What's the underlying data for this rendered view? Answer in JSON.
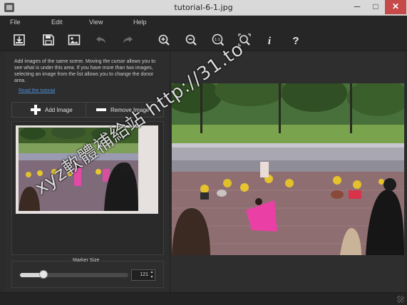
{
  "window": {
    "title": "tutorial-6-1.jpg",
    "min_glyph": "─",
    "max_glyph": "□",
    "close_glyph": "✕"
  },
  "menu": {
    "file": "File",
    "edit": "Edit",
    "view": "View",
    "help": "Help"
  },
  "toolbar": {
    "icons": [
      "open-icon",
      "save-icon",
      "image-icon",
      "undo-icon",
      "redo-icon",
      "zoom-in-icon",
      "zoom-out-icon",
      "actual-size-icon",
      "fit-window-icon",
      "info-icon",
      "help-icon"
    ],
    "actual_size_label": "1:1",
    "info_label": "i",
    "help_label": "?"
  },
  "panel": {
    "help_text": "Add images of the same scene. Moving the cursor allows you to see what is under this area. If you have more than two images, selecting an image from the list allows you to change the donor area.",
    "tutorial_link": "Read the tutorial",
    "add_image_label": "Add Image",
    "remove_image_label": "Remove Image",
    "marker_size_label": "Marker Size",
    "marker_size_value": "121",
    "marker_size_fraction": 0.22
  },
  "watermark": {
    "text": "xyz軟體補給站 http://31.to"
  },
  "colors": {
    "accent_link": "#4d8fd6",
    "close_button": "#c74a4a",
    "background": "#2b2b2b"
  }
}
